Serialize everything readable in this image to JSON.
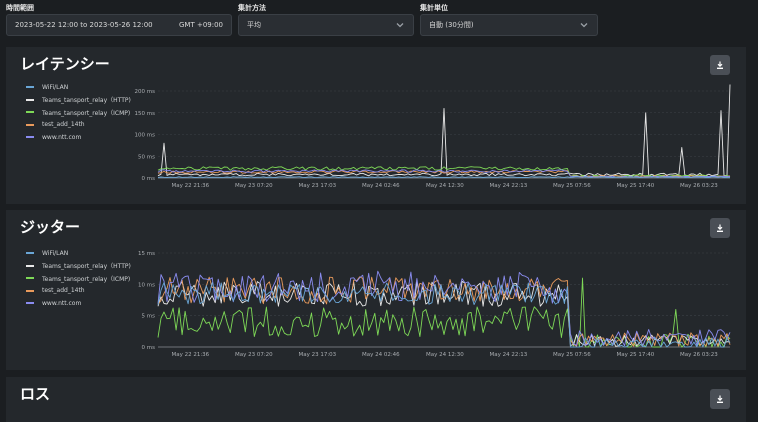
{
  "filters": {
    "range": {
      "label": "時間範囲",
      "value": "2023-05-22 12:00 to 2023-05-26 12:00",
      "tz": "GMT +09:00"
    },
    "method": {
      "label": "集計方法",
      "value": "平均"
    },
    "unit": {
      "label": "集計単位",
      "value": "自動 (30分間)"
    }
  },
  "colors": {
    "wifi": "#6aa6d6",
    "http": "#e8e8e8",
    "icmp": "#7ed957",
    "test": "#e89a5c",
    "ntt": "#8a8cf0"
  },
  "legend": [
    {
      "key": "wifi",
      "label": "WiFi/LAN"
    },
    {
      "key": "http",
      "label": "Teams_tansport_relay（HTTP)"
    },
    {
      "key": "icmp",
      "label": "Teams_tansport_relay（ICMP)"
    },
    {
      "key": "test",
      "label": "test_add_14th"
    },
    {
      "key": "ntt",
      "label": "www.ntt.com"
    }
  ],
  "panels": {
    "latency": {
      "title": "レイテンシー"
    },
    "jitter": {
      "title": "ジッター"
    },
    "loss": {
      "title": "ロス"
    }
  },
  "chart_data": [
    {
      "type": "line",
      "title": "レイテンシー",
      "y_ticks": [
        "0 ms",
        "50 ms",
        "100 ms",
        "150 ms",
        "200 ms"
      ],
      "ylim": [
        0,
        200
      ],
      "x_ticks": [
        "May 22 21:36",
        "May 23 07:20",
        "May 23 17:03",
        "May 24 02:46",
        "May 24 12:30",
        "May 24 22:13",
        "May 25 07:56",
        "May 25 17:40",
        "May 26 03:23"
      ],
      "x_tick_pos": [
        0.095,
        0.206,
        0.317,
        0.428,
        0.54,
        0.651,
        0.762,
        0.873,
        0.984
      ],
      "series": [
        {
          "key": "http",
          "base": 8,
          "noise": 3,
          "spikes": [
            [
              0.01,
              80
            ],
            [
              0.5,
              160
            ],
            [
              0.855,
              150
            ],
            [
              0.915,
              70
            ],
            [
              0.985,
              155
            ],
            [
              0.999,
              215
            ]
          ]
        },
        {
          "key": "icmp",
          "base": 22,
          "noise": 4,
          "drop_at": 0.72,
          "drop_to": 5
        },
        {
          "key": "test",
          "base": 14,
          "noise": 3,
          "drop_at": 0.72,
          "drop_to": 4
        },
        {
          "key": "ntt",
          "base": 16,
          "noise": 3,
          "drop_at": 0.72,
          "drop_to": 3
        },
        {
          "key": "wifi",
          "base": 2,
          "noise": 1
        }
      ]
    },
    {
      "type": "line",
      "title": "ジッター",
      "y_ticks": [
        "0 ms",
        "5 ms",
        "10 ms",
        "15 ms"
      ],
      "ylim": [
        0,
        15
      ],
      "x_ticks": [
        "May 22 21:36",
        "May 23 07:20",
        "May 23 17:03",
        "May 24 02:46",
        "May 24 12:30",
        "May 24 22:13",
        "May 25 07:56",
        "May 25 17:40",
        "May 26 03:23"
      ],
      "x_tick_pos": [
        0.095,
        0.206,
        0.317,
        0.428,
        0.54,
        0.651,
        0.762,
        0.873,
        0.984
      ],
      "series": [
        {
          "key": "icmp",
          "base": 4,
          "noise": 2.5,
          "drop_at": 0.72,
          "drop_to": 0.8,
          "spikes": [
            [
              0.74,
              11
            ],
            [
              0.905,
              6
            ]
          ]
        },
        {
          "key": "http",
          "base": 8.5,
          "noise": 2,
          "drop_at": 0.72,
          "drop_to": 1
        },
        {
          "key": "test",
          "base": 9,
          "noise": 2.2,
          "drop_at": 0.72,
          "drop_to": 1.2
        },
        {
          "key": "ntt",
          "base": 9.5,
          "noise": 2.6,
          "drop_at": 0.72,
          "drop_to": 1.5
        },
        {
          "key": "wifi",
          "base": 8.5,
          "noise": 1.8,
          "drop_at": 0.72,
          "drop_to": 0.6
        }
      ]
    }
  ]
}
